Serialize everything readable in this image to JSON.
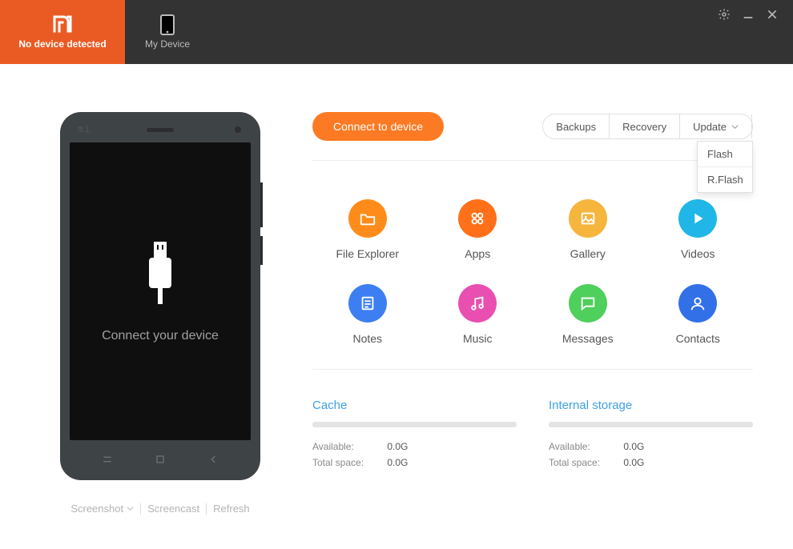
{
  "tabs": {
    "home_subtitle": "No device detected",
    "device_label": "My Device"
  },
  "phone_preview": {
    "message": "Connect your device",
    "brand": "mi"
  },
  "left_actions": {
    "screenshot": "Screenshot",
    "screencast": "Screencast",
    "refresh": "Refresh"
  },
  "buttons": {
    "connect": "Connect to device"
  },
  "pills": {
    "backups": "Backups",
    "recovery": "Recovery",
    "update": "Update"
  },
  "update_menu": {
    "flash": "Flash",
    "rflash": "R.Flash"
  },
  "tiles": [
    {
      "id": "file-explorer",
      "label": "File Explorer",
      "color": "#ff8c1a"
    },
    {
      "id": "apps",
      "label": "Apps",
      "color": "#ff7019"
    },
    {
      "id": "gallery",
      "label": "Gallery",
      "color": "#f6b53c"
    },
    {
      "id": "videos",
      "label": "Videos",
      "color": "#20b7e8"
    },
    {
      "id": "notes",
      "label": "Notes",
      "color": "#3d7ff2"
    },
    {
      "id": "music",
      "label": "Music",
      "color": "#e84fb1"
    },
    {
      "id": "messages",
      "label": "Messages",
      "color": "#4fcf5c"
    },
    {
      "id": "contacts",
      "label": "Contacts",
      "color": "#3270e8"
    }
  ],
  "storage": {
    "cache": {
      "title": "Cache",
      "available_label": "Available:",
      "available": "0.0G",
      "total_label": "Total space:",
      "total": "0.0G"
    },
    "internal": {
      "title": "Internal storage",
      "available_label": "Available:",
      "available": "0.0G",
      "total_label": "Total space:",
      "total": "0.0G"
    }
  }
}
